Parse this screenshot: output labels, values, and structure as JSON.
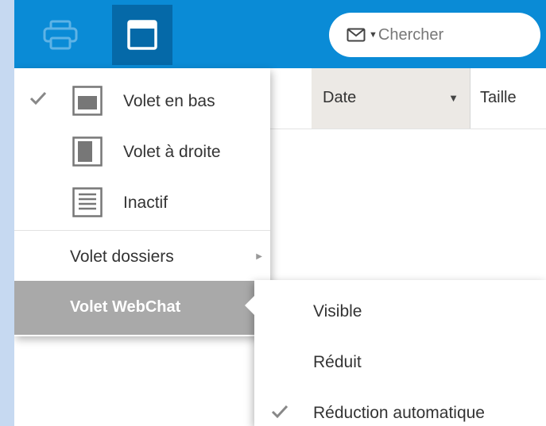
{
  "toolbar": {
    "print_icon": "printer-icon",
    "layout_icon": "reading-pane-icon"
  },
  "search": {
    "icon": "envelope-icon",
    "placeholder": "Chercher"
  },
  "columns": {
    "date": "Date",
    "size": "Taille"
  },
  "menu": {
    "items": [
      {
        "label": "Volet en bas",
        "icon": "pane-bottom-icon",
        "checked": true
      },
      {
        "label": "Volet à droite",
        "icon": "pane-right-icon",
        "checked": false
      },
      {
        "label": "Inactif",
        "icon": "pane-off-icon",
        "checked": false
      },
      {
        "label": "Volet dossiers",
        "has_submenu": true
      },
      {
        "label": "Volet WebChat",
        "has_submenu": true,
        "active": true
      }
    ]
  },
  "submenu": {
    "items": [
      {
        "label": "Visible",
        "checked": false
      },
      {
        "label": "Réduit",
        "checked": false
      },
      {
        "label": "Réduction automatique",
        "checked": true
      }
    ]
  },
  "colors": {
    "toolbar": "#0a8bd6",
    "toolbar_active": "#0569a8",
    "menu_active": "#a9a9a9",
    "frame": "#c6d9f1"
  }
}
